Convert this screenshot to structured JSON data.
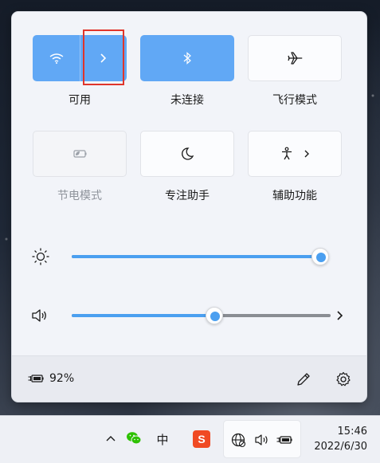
{
  "quick_settings": {
    "tiles": [
      {
        "id": "wifi",
        "label": "可用",
        "state": "on",
        "icon": "wifi-icon"
      },
      {
        "id": "bluetooth",
        "label": "未连接",
        "state": "on",
        "icon": "bluetooth-icon"
      },
      {
        "id": "airplane",
        "label": "飞行模式",
        "state": "off",
        "icon": "airplane-icon"
      },
      {
        "id": "battery-saver",
        "label": "节电模式",
        "state": "disabled",
        "icon": "battery-saver-icon"
      },
      {
        "id": "focus",
        "label": "专注助手",
        "state": "off",
        "icon": "moon-icon"
      },
      {
        "id": "accessibility",
        "label": "辅助功能",
        "state": "off",
        "icon": "accessibility-icon"
      }
    ],
    "brightness": {
      "icon": "sun-icon",
      "level": 1.0
    },
    "volume": {
      "icon": "speaker-icon",
      "level": 0.55
    },
    "battery": {
      "icon": "battery-charging-icon",
      "percent_label": "92%"
    },
    "accent_color": "#61a8f5",
    "highlight_color": "#e0352b"
  },
  "taskbar": {
    "tray": [
      {
        "name": "show-hidden-icons-chevron",
        "icon": "chevron-up-icon"
      },
      {
        "name": "wechat-tray",
        "icon": "wechat-icon"
      },
      {
        "name": "ime-indicator",
        "label": "中"
      },
      {
        "name": "sogou-ime",
        "label": "S",
        "icon": "sogou-icon"
      }
    ],
    "clock": {
      "time": "15:46",
      "date": "2022/6/30"
    }
  }
}
